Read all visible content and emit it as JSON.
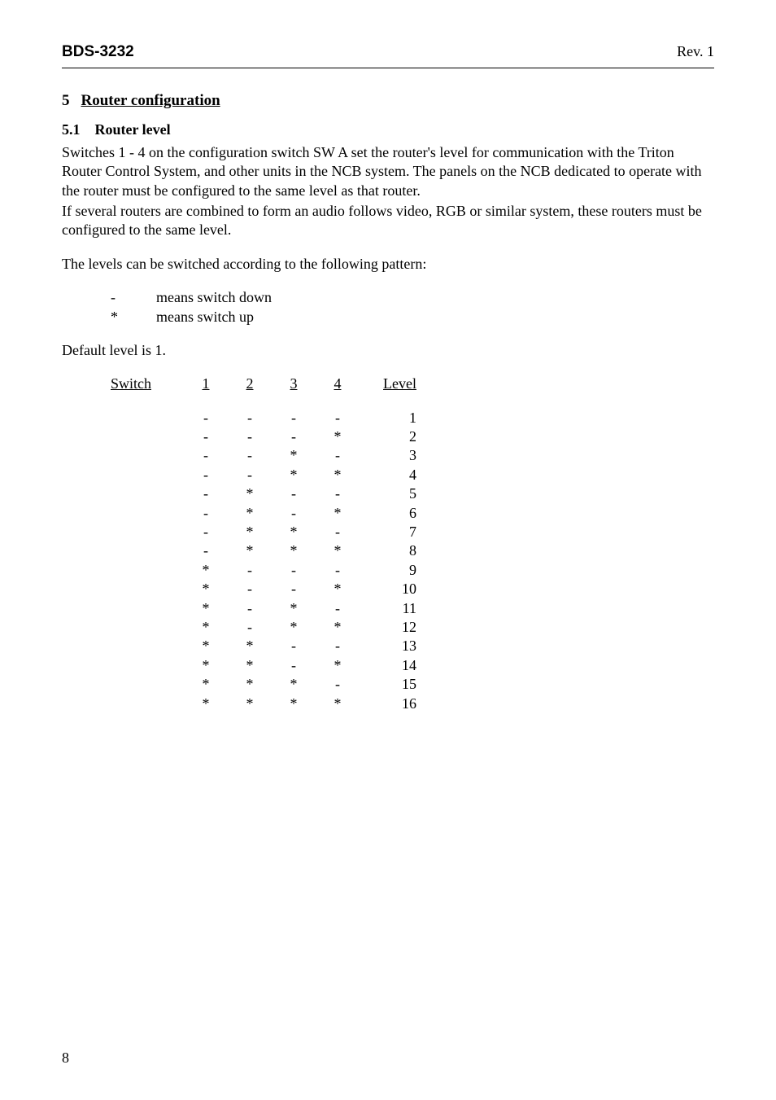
{
  "header": {
    "left": "BDS-3232",
    "right": "Rev. 1"
  },
  "section": {
    "num": "5",
    "title": "Router configuration"
  },
  "subsection": {
    "num": "5.1",
    "title": "Router level"
  },
  "paras": {
    "p1": "Switches 1 - 4 on the configuration switch SW A set the router's level for communication with the Triton Router Control System, and other units in the NCB system. The panels on the NCB dedicated to operate with the router must be configured to the same level as that router.",
    "p2": "If several routers are combined to form an audio follows video, RGB or similar system, these routers must be configured to the same level.",
    "p3": "The levels can be switched according to the following pattern:",
    "legend_down_sym": "-",
    "legend_down_text": "means switch down",
    "legend_up_sym": "*",
    "legend_up_text": "means switch up",
    "default": "Default level is 1."
  },
  "table": {
    "col_label": "Switch",
    "col1": "1",
    "col2": "2",
    "col3": "3",
    "col4": "4",
    "col_level": "Level"
  },
  "chart_data": {
    "type": "table",
    "columns": [
      "Switch 1",
      "Switch 2",
      "Switch 3",
      "Switch 4",
      "Level"
    ],
    "rows": [
      [
        "-",
        "-",
        "-",
        "-",
        1
      ],
      [
        "-",
        "-",
        "-",
        "*",
        2
      ],
      [
        "-",
        "-",
        "*",
        "-",
        3
      ],
      [
        "-",
        "-",
        "*",
        "*",
        4
      ],
      [
        "-",
        "*",
        "-",
        "-",
        5
      ],
      [
        "-",
        "*",
        "-",
        "*",
        6
      ],
      [
        "-",
        "*",
        "*",
        "-",
        7
      ],
      [
        "-",
        "*",
        "*",
        "*",
        8
      ],
      [
        "*",
        "-",
        "-",
        "-",
        9
      ],
      [
        "*",
        "-",
        "-",
        "*",
        10
      ],
      [
        "*",
        "-",
        "*",
        "-",
        11
      ],
      [
        "*",
        "-",
        "*",
        "*",
        12
      ],
      [
        "*",
        "*",
        "-",
        "-",
        13
      ],
      [
        "*",
        "*",
        "-",
        "*",
        14
      ],
      [
        "*",
        "*",
        "*",
        "-",
        15
      ],
      [
        "*",
        "*",
        "*",
        "*",
        16
      ]
    ]
  },
  "footer": {
    "page": "8"
  }
}
